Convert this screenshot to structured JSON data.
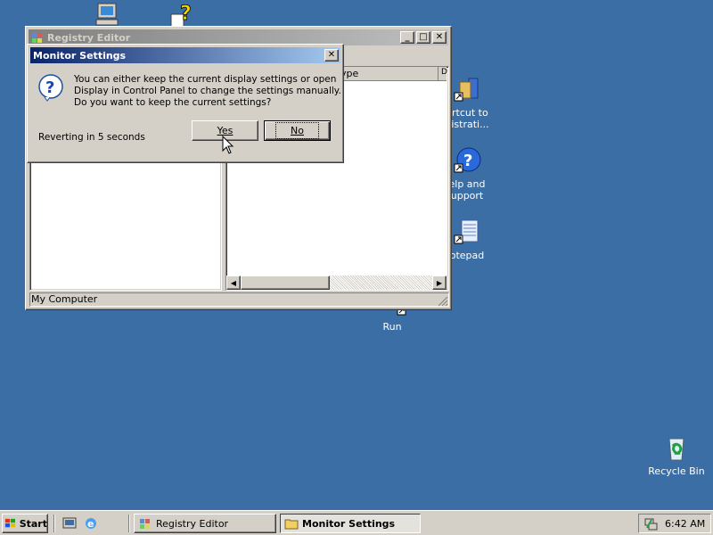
{
  "desktop": {
    "icons": [
      {
        "label": ""
      },
      {
        "label": ""
      },
      {
        "label": "ortcut to"
      },
      {
        "label": "nistrati..."
      },
      {
        "label": "elp and"
      },
      {
        "label": "upport"
      },
      {
        "label": "otepad"
      },
      {
        "label": "Run"
      },
      {
        "label": "Recycle Bin"
      }
    ]
  },
  "registry_editor": {
    "title": "Registry Editor",
    "column_type": "ype",
    "column_data": "D",
    "status": "My Computer",
    "buttons": {
      "minimize": "_",
      "maximize": "□",
      "close": "✕"
    }
  },
  "dialog": {
    "title": "Monitor Settings",
    "close": "✕",
    "message_line1": "You can either keep the current display settings or open",
    "message_line2": "Display in Control Panel to change the settings manually.",
    "message_line3": "Do you want to keep the current settings?",
    "countdown": "Reverting in 5 seconds",
    "yes_label": "Yes",
    "no_label": "No"
  },
  "taskbar": {
    "start_label": "Start",
    "tasks": [
      {
        "label": "Registry Editor"
      },
      {
        "label": "Monitor Settings"
      }
    ],
    "clock": "6:42 AM"
  },
  "colors": {
    "desktop": "#3a6ea5",
    "active_title": "#0a246a",
    "inactive_title": "#808080",
    "face": "#d4d0c8"
  }
}
